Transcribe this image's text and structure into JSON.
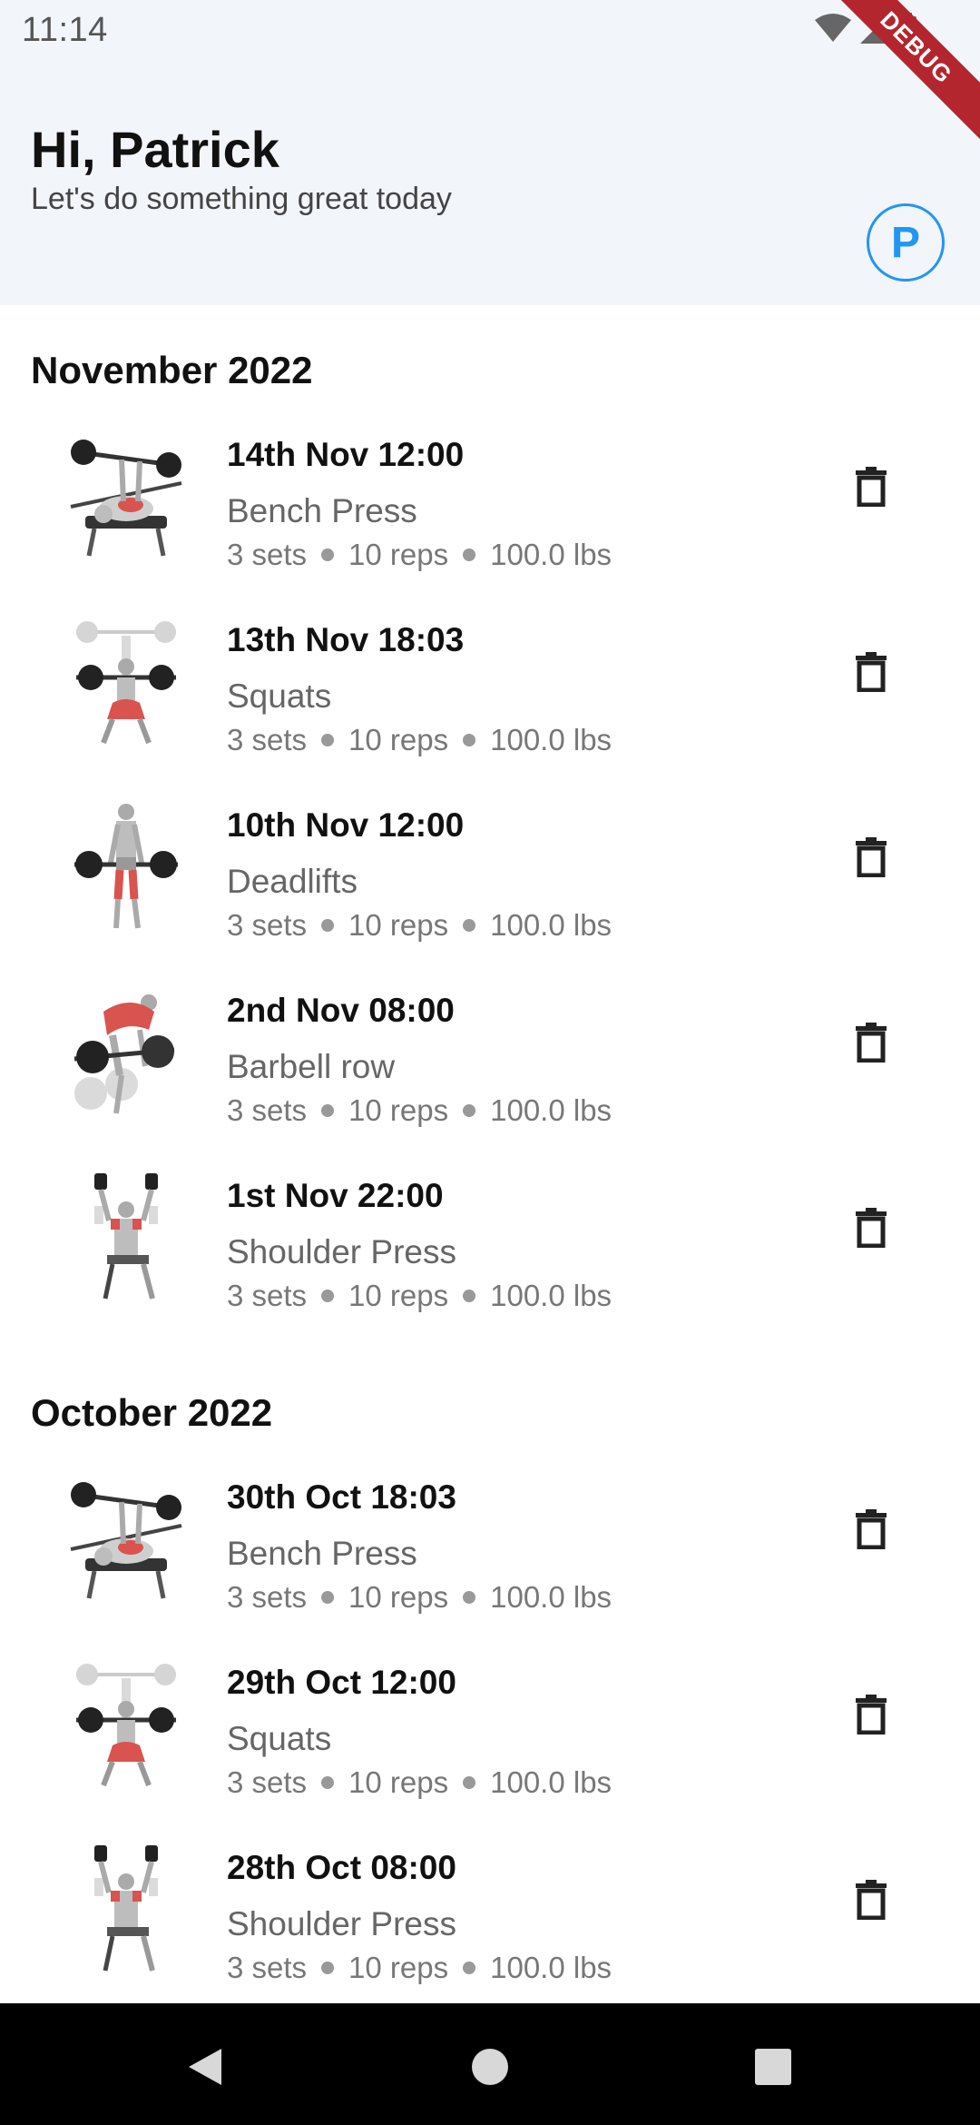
{
  "status_bar": {
    "time": "11:14",
    "icons": [
      "wifi-icon",
      "signal-icon",
      "battery-icon"
    ]
  },
  "debug_banner": "DEBUG",
  "header": {
    "greeting": "Hi, Patrick",
    "subtitle": "Let's do something great today",
    "avatar_letter": "P"
  },
  "colors": {
    "accent": "#2196f3",
    "header_bg": "#f2f5fa",
    "muscle_highlight": "#d9534f"
  },
  "months": [
    {
      "title": "November 2022",
      "entries": [
        {
          "date": "14th Nov 12:00",
          "exercise": "Bench Press",
          "sets": "3 sets",
          "reps": "10 reps",
          "weight": "100.0 lbs",
          "icon": "bench-press-icon"
        },
        {
          "date": "13th Nov 18:03",
          "exercise": "Squats",
          "sets": "3 sets",
          "reps": "10 reps",
          "weight": "100.0 lbs",
          "icon": "squats-icon"
        },
        {
          "date": "10th Nov 12:00",
          "exercise": "Deadlifts",
          "sets": "3 sets",
          "reps": "10 reps",
          "weight": "100.0 lbs",
          "icon": "deadlift-icon"
        },
        {
          "date": "2nd Nov 08:00",
          "exercise": "Barbell row",
          "sets": "3 sets",
          "reps": "10 reps",
          "weight": "100.0 lbs",
          "icon": "barbell-row-icon"
        },
        {
          "date": "1st Nov 22:00",
          "exercise": "Shoulder Press",
          "sets": "3 sets",
          "reps": "10 reps",
          "weight": "100.0 lbs",
          "icon": "shoulder-press-icon"
        }
      ]
    },
    {
      "title": "October 2022",
      "entries": [
        {
          "date": "30th Oct 18:03",
          "exercise": "Bench Press",
          "sets": "3 sets",
          "reps": "10 reps",
          "weight": "100.0 lbs",
          "icon": "bench-press-icon"
        },
        {
          "date": "29th Oct 12:00",
          "exercise": "Squats",
          "sets": "3 sets",
          "reps": "10 reps",
          "weight": "100.0 lbs",
          "icon": "squats-icon"
        },
        {
          "date": "28th Oct 08:00",
          "exercise": "Shoulder Press",
          "sets": "3 sets",
          "reps": "10 reps",
          "weight": "100.0 lbs",
          "icon": "shoulder-press-icon"
        }
      ]
    }
  ],
  "nav_bar": {
    "buttons": [
      "back-icon",
      "home-icon",
      "recents-icon"
    ]
  }
}
